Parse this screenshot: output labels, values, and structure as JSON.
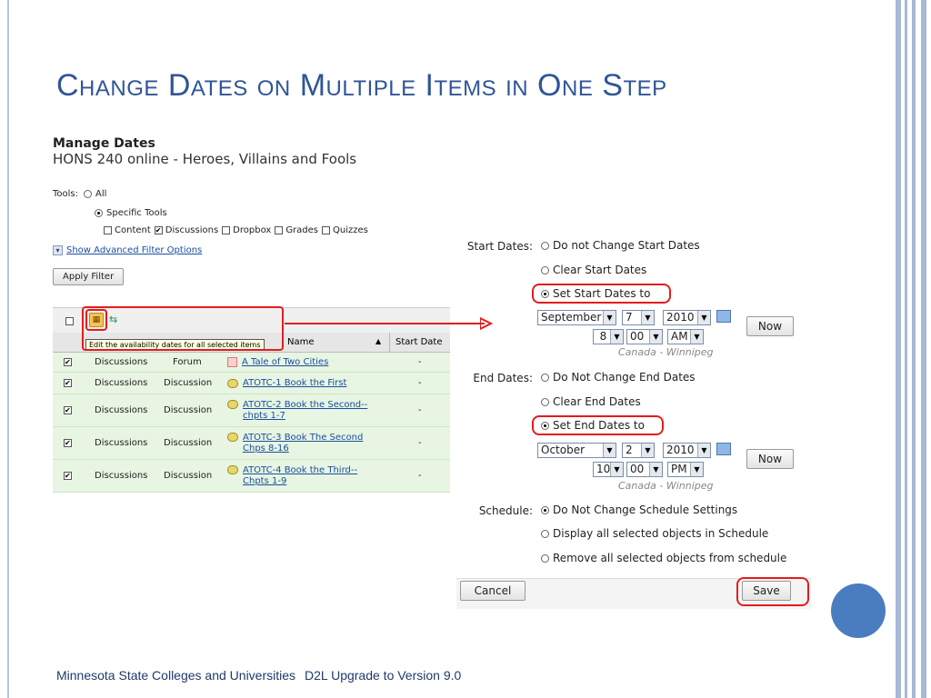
{
  "slide": {
    "title": "Change Dates on Multiple Items in One Step",
    "footer_left": "Minnesota State Colleges and Universities",
    "footer_right": "D2L Upgrade to Version 9.0"
  },
  "colors": {
    "title": "#2f5597",
    "highlight": "#e11d1d",
    "row_bg": "#e7f5e2",
    "circle": "#4a7cc0"
  },
  "manage": {
    "title": "Manage Dates",
    "course": "HONS 240 online - Heroes, Villains and Fools",
    "tools_label": "Tools:",
    "tool_all": "All",
    "tool_specific": "Specific Tools",
    "tool_checks": [
      {
        "label": "Content",
        "checked": false
      },
      {
        "label": "Discussions",
        "checked": true
      },
      {
        "label": "Dropbox",
        "checked": false
      },
      {
        "label": "Grades",
        "checked": false
      },
      {
        "label": "Quizzes",
        "checked": false
      }
    ],
    "advanced_link": "Show Advanced Filter Options",
    "apply_button": "Apply Filter",
    "tooltip": "Edit the availability dates for all selected items",
    "col_name": "Name",
    "col_start": "Start Date",
    "rows": [
      {
        "tool": "Discussions",
        "type": "Forum",
        "name": "A Tale of Two Cities",
        "start": "-"
      },
      {
        "tool": "Discussions",
        "type": "Discussion",
        "name": "ATOTC-1 Book the First",
        "start": "-"
      },
      {
        "tool": "Discussions",
        "type": "Discussion",
        "name": "ATOTC-2 Book the Second--chpts 1-7",
        "start": "-"
      },
      {
        "tool": "Discussions",
        "type": "Discussion",
        "name": "ATOTC-3 Book The Second Chps 8-16",
        "start": "-"
      },
      {
        "tool": "Discussions",
        "type": "Discussion",
        "name": "ATOTC-4 Book the Third--Chpts 1-9",
        "start": "-"
      }
    ]
  },
  "dates": {
    "start_label": "Start Dates:",
    "start_opt1": "Do not Change Start Dates",
    "start_opt2": "Clear Start Dates",
    "start_opt3": "Set Start Dates to",
    "start_month": "September",
    "start_day": "7",
    "start_year": "2010",
    "start_hour": "8",
    "start_min": "00",
    "start_ampm": "AM",
    "now": "Now",
    "timezone": "Canada - Winnipeg",
    "end_label": "End Dates:",
    "end_opt1": "Do Not Change End Dates",
    "end_opt2": "Clear End Dates",
    "end_opt3": "Set End Dates to",
    "end_month": "October",
    "end_day": "2",
    "end_year": "2010",
    "end_hour": "10",
    "end_min": "00",
    "end_ampm": "PM",
    "schedule_label": "Schedule:",
    "sched_opt1": "Do Not Change Schedule Settings",
    "sched_opt2": "Display all selected objects in Schedule",
    "sched_opt3": "Remove all selected objects from schedule",
    "cancel": "Cancel",
    "save": "Save"
  }
}
